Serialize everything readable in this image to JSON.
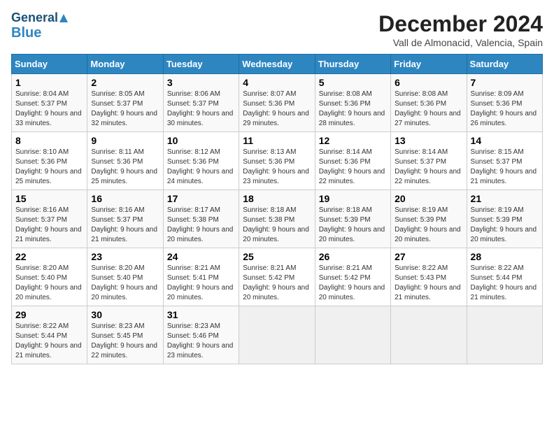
{
  "header": {
    "logo_line1": "General",
    "logo_line2": "Blue",
    "title": "December 2024",
    "subtitle": "Vall de Almonacid, Valencia, Spain"
  },
  "weekdays": [
    "Sunday",
    "Monday",
    "Tuesday",
    "Wednesday",
    "Thursday",
    "Friday",
    "Saturday"
  ],
  "weeks": [
    [
      {
        "day": "1",
        "info": "Sunrise: 8:04 AM\nSunset: 5:37 PM\nDaylight: 9 hours and 33 minutes."
      },
      {
        "day": "2",
        "info": "Sunrise: 8:05 AM\nSunset: 5:37 PM\nDaylight: 9 hours and 32 minutes."
      },
      {
        "day": "3",
        "info": "Sunrise: 8:06 AM\nSunset: 5:37 PM\nDaylight: 9 hours and 30 minutes."
      },
      {
        "day": "4",
        "info": "Sunrise: 8:07 AM\nSunset: 5:36 PM\nDaylight: 9 hours and 29 minutes."
      },
      {
        "day": "5",
        "info": "Sunrise: 8:08 AM\nSunset: 5:36 PM\nDaylight: 9 hours and 28 minutes."
      },
      {
        "day": "6",
        "info": "Sunrise: 8:08 AM\nSunset: 5:36 PM\nDaylight: 9 hours and 27 minutes."
      },
      {
        "day": "7",
        "info": "Sunrise: 8:09 AM\nSunset: 5:36 PM\nDaylight: 9 hours and 26 minutes."
      }
    ],
    [
      {
        "day": "8",
        "info": "Sunrise: 8:10 AM\nSunset: 5:36 PM\nDaylight: 9 hours and 25 minutes."
      },
      {
        "day": "9",
        "info": "Sunrise: 8:11 AM\nSunset: 5:36 PM\nDaylight: 9 hours and 25 minutes."
      },
      {
        "day": "10",
        "info": "Sunrise: 8:12 AM\nSunset: 5:36 PM\nDaylight: 9 hours and 24 minutes."
      },
      {
        "day": "11",
        "info": "Sunrise: 8:13 AM\nSunset: 5:36 PM\nDaylight: 9 hours and 23 minutes."
      },
      {
        "day": "12",
        "info": "Sunrise: 8:14 AM\nSunset: 5:36 PM\nDaylight: 9 hours and 22 minutes."
      },
      {
        "day": "13",
        "info": "Sunrise: 8:14 AM\nSunset: 5:37 PM\nDaylight: 9 hours and 22 minutes."
      },
      {
        "day": "14",
        "info": "Sunrise: 8:15 AM\nSunset: 5:37 PM\nDaylight: 9 hours and 21 minutes."
      }
    ],
    [
      {
        "day": "15",
        "info": "Sunrise: 8:16 AM\nSunset: 5:37 PM\nDaylight: 9 hours and 21 minutes."
      },
      {
        "day": "16",
        "info": "Sunrise: 8:16 AM\nSunset: 5:37 PM\nDaylight: 9 hours and 21 minutes."
      },
      {
        "day": "17",
        "info": "Sunrise: 8:17 AM\nSunset: 5:38 PM\nDaylight: 9 hours and 20 minutes."
      },
      {
        "day": "18",
        "info": "Sunrise: 8:18 AM\nSunset: 5:38 PM\nDaylight: 9 hours and 20 minutes."
      },
      {
        "day": "19",
        "info": "Sunrise: 8:18 AM\nSunset: 5:39 PM\nDaylight: 9 hours and 20 minutes."
      },
      {
        "day": "20",
        "info": "Sunrise: 8:19 AM\nSunset: 5:39 PM\nDaylight: 9 hours and 20 minutes."
      },
      {
        "day": "21",
        "info": "Sunrise: 8:19 AM\nSunset: 5:39 PM\nDaylight: 9 hours and 20 minutes."
      }
    ],
    [
      {
        "day": "22",
        "info": "Sunrise: 8:20 AM\nSunset: 5:40 PM\nDaylight: 9 hours and 20 minutes."
      },
      {
        "day": "23",
        "info": "Sunrise: 8:20 AM\nSunset: 5:40 PM\nDaylight: 9 hours and 20 minutes."
      },
      {
        "day": "24",
        "info": "Sunrise: 8:21 AM\nSunset: 5:41 PM\nDaylight: 9 hours and 20 minutes."
      },
      {
        "day": "25",
        "info": "Sunrise: 8:21 AM\nSunset: 5:42 PM\nDaylight: 9 hours and 20 minutes."
      },
      {
        "day": "26",
        "info": "Sunrise: 8:21 AM\nSunset: 5:42 PM\nDaylight: 9 hours and 20 minutes."
      },
      {
        "day": "27",
        "info": "Sunrise: 8:22 AM\nSunset: 5:43 PM\nDaylight: 9 hours and 21 minutes."
      },
      {
        "day": "28",
        "info": "Sunrise: 8:22 AM\nSunset: 5:44 PM\nDaylight: 9 hours and 21 minutes."
      }
    ],
    [
      {
        "day": "29",
        "info": "Sunrise: 8:22 AM\nSunset: 5:44 PM\nDaylight: 9 hours and 21 minutes."
      },
      {
        "day": "30",
        "info": "Sunrise: 8:23 AM\nSunset: 5:45 PM\nDaylight: 9 hours and 22 minutes."
      },
      {
        "day": "31",
        "info": "Sunrise: 8:23 AM\nSunset: 5:46 PM\nDaylight: 9 hours and 23 minutes."
      },
      null,
      null,
      null,
      null
    ]
  ]
}
